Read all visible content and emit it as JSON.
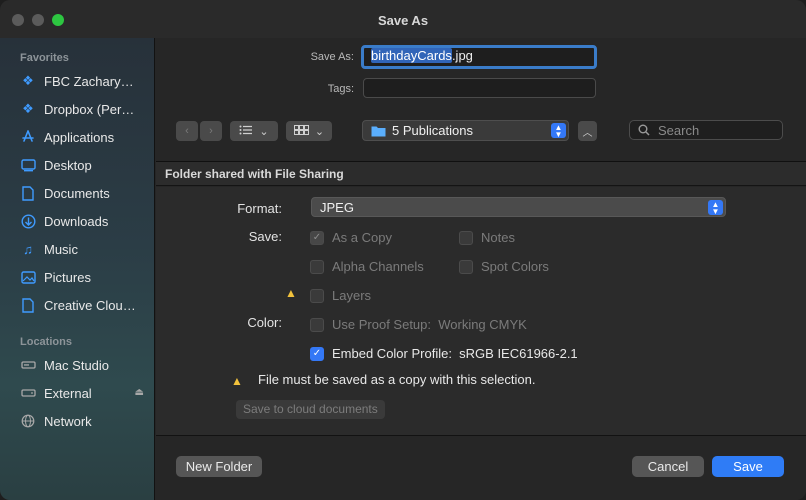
{
  "window": {
    "title": "Save As"
  },
  "sidebar": {
    "favorites_heading": "Favorites",
    "favorites": [
      {
        "label": "FBC Zachary…",
        "icon": "dropbox-icon"
      },
      {
        "label": "Dropbox (Per…",
        "icon": "dropbox-icon"
      },
      {
        "label": "Applications",
        "icon": "applications-icon"
      },
      {
        "label": "Desktop",
        "icon": "desktop-icon"
      },
      {
        "label": "Documents",
        "icon": "document-icon"
      },
      {
        "label": "Downloads",
        "icon": "downloads-icon"
      },
      {
        "label": "Music",
        "icon": "music-icon"
      },
      {
        "label": "Pictures",
        "icon": "pictures-icon"
      },
      {
        "label": "Creative Clou…",
        "icon": "document-icon"
      }
    ],
    "locations_heading": "Locations",
    "locations": [
      {
        "label": "Mac Studio",
        "icon": "computer-icon"
      },
      {
        "label": "External",
        "icon": "drive-icon"
      },
      {
        "label": "Network",
        "icon": "network-icon"
      }
    ]
  },
  "form": {
    "save_as_label": "Save As:",
    "filename_base": "birthdayCards",
    "filename_ext": ".jpg",
    "tags_label": "Tags:",
    "tags_value": ""
  },
  "toolbar": {
    "location": "5 Publications",
    "search_placeholder": "Search"
  },
  "shared_bar": "Folder shared with File Sharing",
  "options": {
    "format_label": "Format:",
    "format_value": "JPEG",
    "save_label": "Save:",
    "color_label": "Color:",
    "as_copy": "As a Copy",
    "notes": "Notes",
    "alpha_channels": "Alpha Channels",
    "spot_colors": "Spot Colors",
    "layers": "Layers",
    "use_proof_setup": "Use Proof Setup:  Working CMYK",
    "embed_profile": "Embed Color Profile:  sRGB IEC61966-2.1",
    "warning": "File must be saved as a copy with this selection.",
    "cloud_button": "Save to cloud documents"
  },
  "footer": {
    "new_folder": "New Folder",
    "cancel": "Cancel",
    "save": "Save"
  },
  "colors": {
    "accent": "#2f7cf6",
    "warning": "#f2c23c"
  }
}
